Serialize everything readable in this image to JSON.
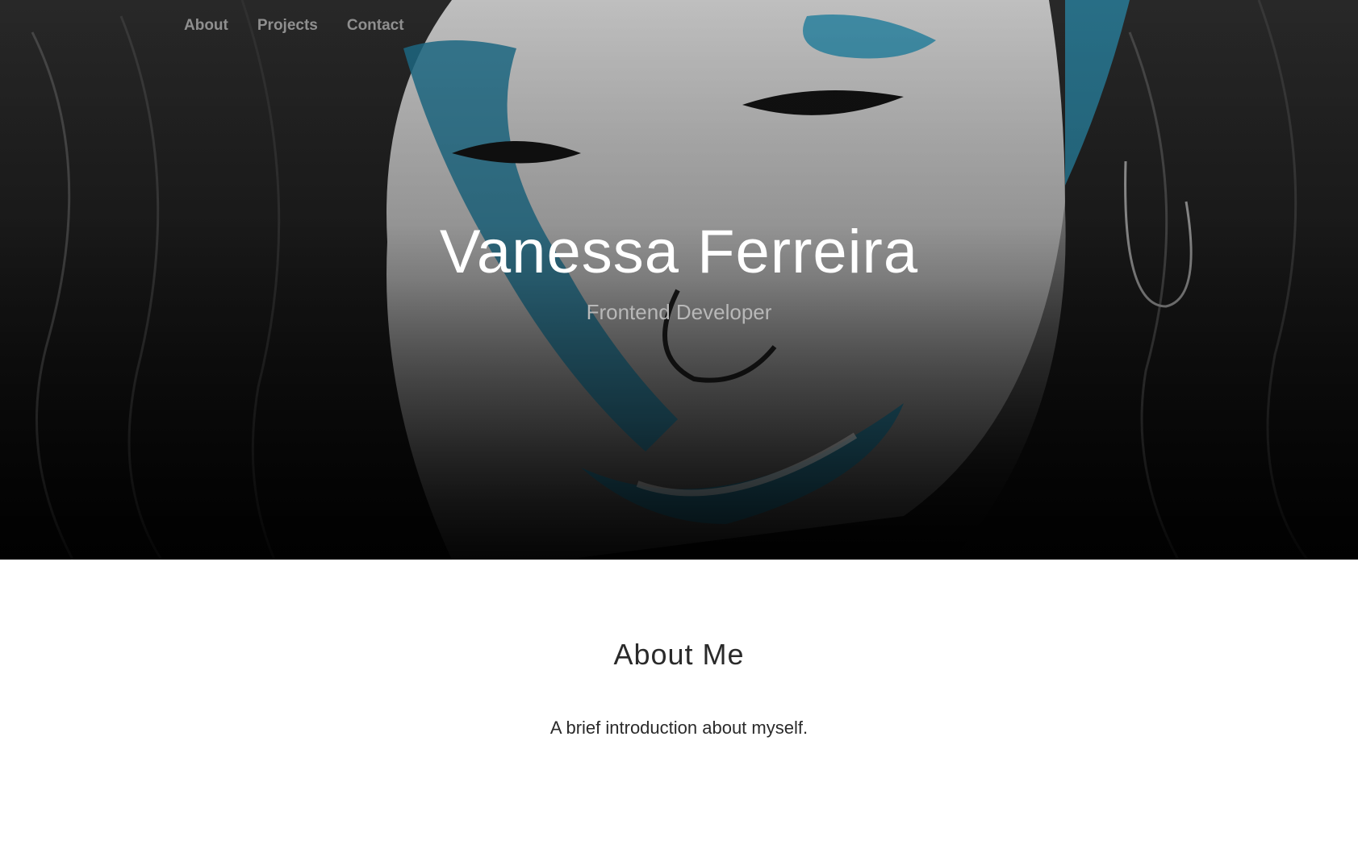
{
  "nav": {
    "items": [
      {
        "label": "About"
      },
      {
        "label": "Projects"
      },
      {
        "label": "Contact"
      }
    ]
  },
  "hero": {
    "title": "Vanessa Ferreira",
    "subtitle": "Frontend Developer",
    "accent_color": "#1f7f9e"
  },
  "about": {
    "title": "About Me",
    "text": "A brief introduction about myself."
  }
}
